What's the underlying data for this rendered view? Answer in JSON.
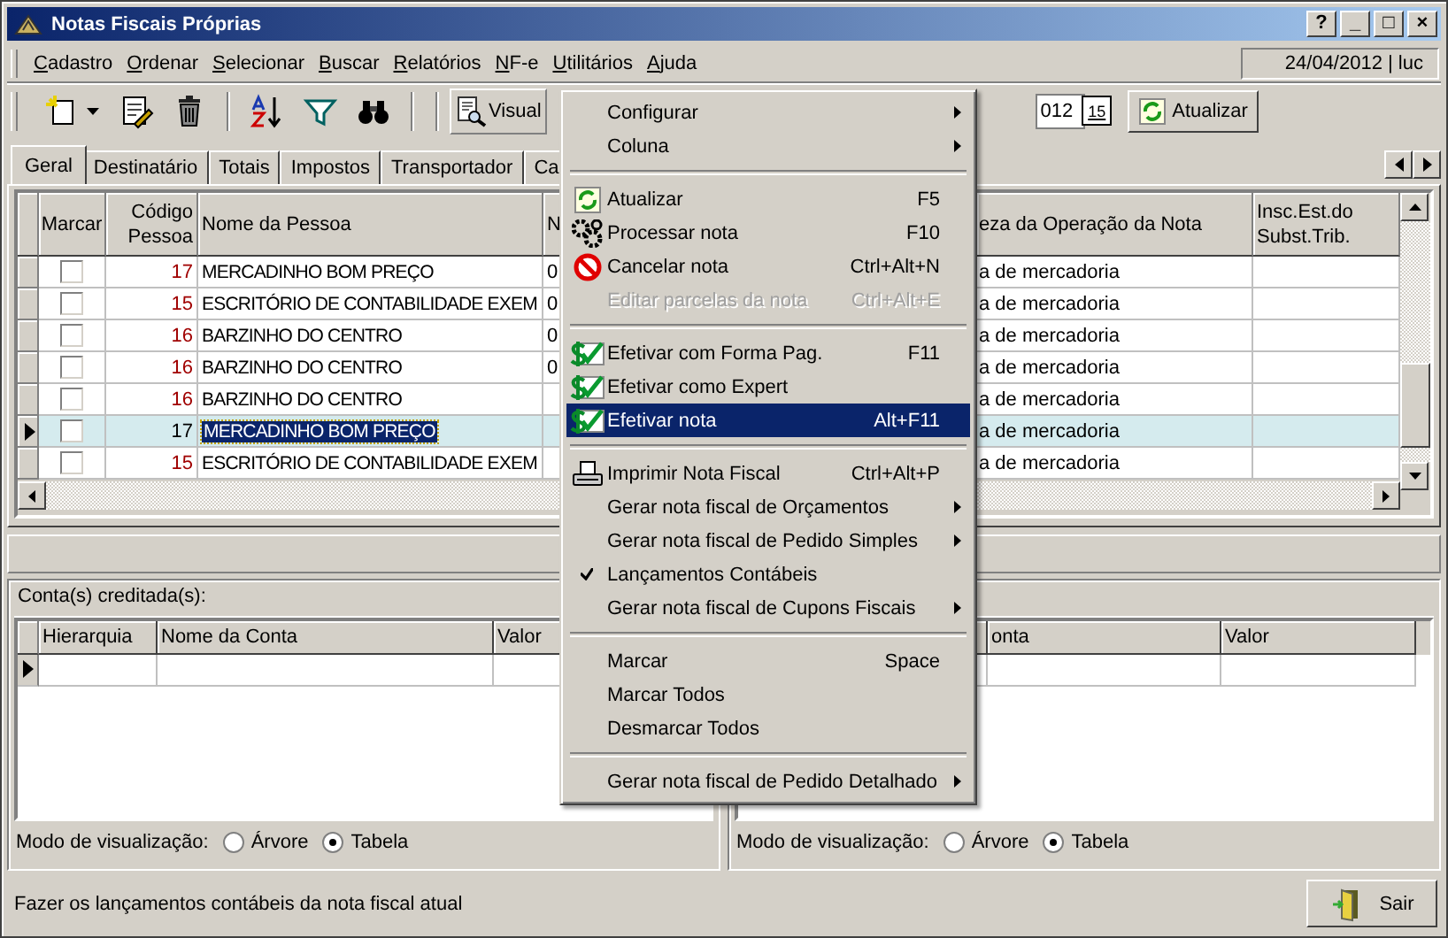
{
  "window": {
    "title": "Notas Fiscais Próprias",
    "controls": [
      "?",
      "_",
      "□",
      "×"
    ]
  },
  "menu_bar": {
    "items": [
      "Cadastro",
      "Ordenar",
      "Selecionar",
      "Buscar",
      "Relatórios",
      "NF-e",
      "Utilitários",
      "Ajuda"
    ],
    "session": "24/04/2012 | luc"
  },
  "toolbar": {
    "view_button": "Visual",
    "date_field": "012",
    "calendar_button": "15",
    "refresh_button": "Atualizar"
  },
  "tabs": [
    {
      "label": "Geral",
      "selected": true
    },
    {
      "label": "Destinatário",
      "selected": false
    },
    {
      "label": "Totais",
      "selected": false
    },
    {
      "label": "Impostos",
      "selected": false
    },
    {
      "label": "Transportador",
      "selected": false
    },
    {
      "label": "Ca",
      "selected": false
    }
  ],
  "table": {
    "columns": [
      "Marcar",
      "Código Pessoa",
      "Nome da Pessoa",
      "N",
      "eza da Operação da Nota",
      "Insc.Est.do Subst.Trib."
    ],
    "rows": [
      {
        "checked": false,
        "selected": false,
        "code": "17",
        "name": "MERCADINHO BOM PREÇO",
        "column_4": "0",
        "operation": "a de mercadoria"
      },
      {
        "checked": false,
        "selected": false,
        "code": "15",
        "name": "ESCRITÓRIO DE CONTABILIDADE EXEM",
        "column_4": "0",
        "operation": "a de mercadoria"
      },
      {
        "checked": false,
        "selected": false,
        "code": "16",
        "name": "BARZINHO DO CENTRO",
        "column_4": "0",
        "operation": "a de mercadoria"
      },
      {
        "checked": false,
        "selected": false,
        "code": "16",
        "name": "BARZINHO DO CENTRO",
        "column_4": "0",
        "operation": "a de mercadoria"
      },
      {
        "checked": false,
        "selected": false,
        "code": "16",
        "name": "BARZINHO DO CENTRO",
        "operation": "a de mercadoria"
      },
      {
        "checked": false,
        "selected": true,
        "code": "17",
        "name": "MERCADINHO BOM PREÇO",
        "operation": "a de mercadoria"
      },
      {
        "checked": false,
        "selected": false,
        "code": "15",
        "name": "ESCRITÓRIO DE CONTABILIDADE EXEM",
        "operation": "a de mercadoria"
      }
    ]
  },
  "credit_panel": {
    "title": "Conta(s) creditada(s):",
    "columns": [
      "Hierarquia",
      "Nome da Conta",
      "Valor"
    ],
    "view_label": "Modo de visualização:",
    "view_options": [
      {
        "label": "Árvore",
        "selected": false
      },
      {
        "label": "Tabela",
        "selected": true
      }
    ]
  },
  "debit_panel": {
    "columns": [
      "onta",
      "Valor"
    ],
    "view_label": "Modo de visualização:",
    "view_options": [
      {
        "label": "Árvore",
        "selected": false
      },
      {
        "label": "Tabela",
        "selected": true
      }
    ]
  },
  "context_menu": [
    {
      "kind": "submenu",
      "label": "Configurar",
      "disabled": false,
      "checked": false,
      "selected": false
    },
    {
      "kind": "submenu",
      "label": "Coluna",
      "disabled": false,
      "checked": false,
      "selected": false
    },
    {
      "kind": "separator"
    },
    {
      "kind": "refresh",
      "label": "Atualizar",
      "shortcut": "F5",
      "disabled": false,
      "checked": false,
      "selected": false
    },
    {
      "kind": "process",
      "label": "Processar nota",
      "shortcut": "F10",
      "disabled": false,
      "checked": false,
      "selected": false
    },
    {
      "kind": "cancel",
      "label": "Cancelar nota",
      "shortcut": "Ctrl+Alt+N",
      "disabled": false,
      "checked": false,
      "selected": false
    },
    {
      "kind": "plain",
      "label": "Editar parcelas da nota",
      "shortcut": "Ctrl+Alt+E",
      "disabled": true,
      "checked": false,
      "selected": false
    },
    {
      "kind": "separator"
    },
    {
      "kind": "effect",
      "label": "Efetivar com Forma Pag.",
      "shortcut": "F11",
      "disabled": false,
      "checked": false,
      "selected": false
    },
    {
      "kind": "effect",
      "label": "Efetivar como Expert",
      "disabled": false,
      "checked": false,
      "selected": false
    },
    {
      "kind": "effect",
      "label": "Efetivar nota",
      "shortcut": "Alt+F11",
      "disabled": false,
      "checked": false,
      "selected": true
    },
    {
      "kind": "separator"
    },
    {
      "kind": "print",
      "label": "Imprimir Nota Fiscal",
      "shortcut": "Ctrl+Alt+P",
      "disabled": false,
      "checked": false,
      "selected": false
    },
    {
      "kind": "submenu",
      "label": "Gerar nota fiscal de Orçamentos",
      "disabled": false,
      "checked": false,
      "selected": false
    },
    {
      "kind": "submenu",
      "label": "Gerar nota fiscal de Pedido Simples",
      "disabled": false,
      "checked": false,
      "selected": false
    },
    {
      "kind": "plain",
      "label": "Lançamentos Contábeis",
      "disabled": false,
      "checked": true,
      "selected": false
    },
    {
      "kind": "submenu",
      "label": "Gerar nota fiscal de Cupons Fiscais",
      "disabled": false,
      "checked": false,
      "selected": false
    },
    {
      "kind": "separator"
    },
    {
      "kind": "plain",
      "label": "Marcar",
      "shortcut": "Space",
      "disabled": false,
      "checked": false,
      "selected": false
    },
    {
      "kind": "plain",
      "label": "Marcar Todos",
      "disabled": false,
      "checked": false,
      "selected": false
    },
    {
      "kind": "plain",
      "label": "Desmarcar Todos",
      "disabled": false,
      "checked": false,
      "selected": false
    },
    {
      "kind": "separator"
    },
    {
      "kind": "submenu",
      "label": "Gerar nota fiscal de Pedido Detalhado",
      "disabled": false,
      "checked": false,
      "selected": false
    }
  ],
  "status_bar": {
    "message": "Fazer os lançamentos contábeis da nota fiscal atual",
    "exit_button": "Sair"
  }
}
